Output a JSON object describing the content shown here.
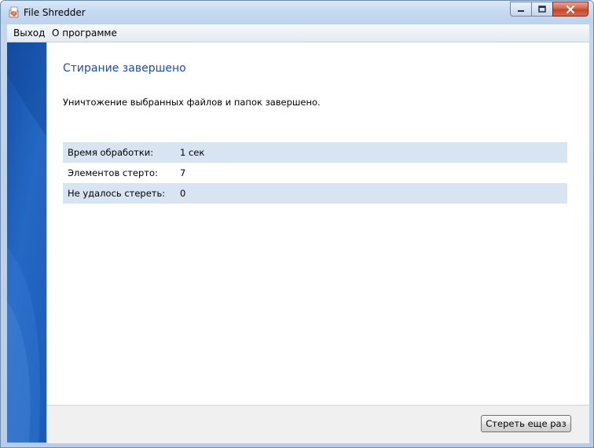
{
  "window": {
    "title": "File Shredder"
  },
  "menu": {
    "items": [
      {
        "label": "Выход"
      },
      {
        "label": "О программе"
      }
    ]
  },
  "main": {
    "heading": "Стирание завершено",
    "message": "Уничтожение выбранных файлов и папок завершено.",
    "stats": [
      {
        "label": "Время обработки:",
        "value": "1 сек"
      },
      {
        "label": "Элементов стерто:",
        "value": "7"
      },
      {
        "label": "Не удалось стереть:",
        "value": "0"
      }
    ]
  },
  "footer": {
    "button_label": "Стереть еще раз"
  },
  "colors": {
    "heading": "#1a4cbf",
    "row_shade": "#d8e4f2",
    "sidebar": "#1a5bb8"
  },
  "icons": {
    "app": "file-shredder-app-icon",
    "minimize": "minimize-icon",
    "maximize": "maximize-icon",
    "close": "close-icon"
  }
}
